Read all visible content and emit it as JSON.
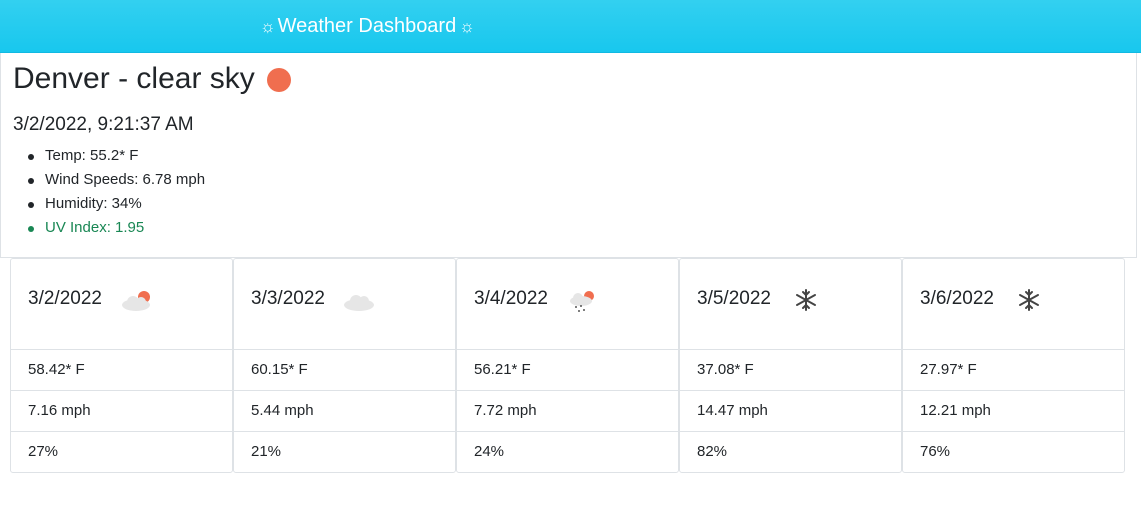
{
  "header": {
    "title": "Weather Dashboard",
    "left_icon": "sun-icon",
    "right_icon": "sun-icon"
  },
  "current": {
    "city": "Denver",
    "separator": "-",
    "description": "clear sky",
    "icon": "clear-day-icon",
    "datetime": "3/2/2022, 9:21:37 AM",
    "metrics": [
      "Temp: 55.2* F",
      "Wind Speeds: 6.78 mph",
      "Humidity: 34%",
      "UV Index: 1.95"
    ],
    "uv_color": "#198754",
    "sun_color": "#f06e4f"
  },
  "forecast": [
    {
      "date": "3/2/2022",
      "icon": "partly-cloudy-day-icon",
      "temp": "58.42* F",
      "wind": "7.16 mph",
      "humidity": "27%"
    },
    {
      "date": "3/3/2022",
      "icon": "cloud-icon",
      "temp": "60.15* F",
      "wind": "5.44 mph",
      "humidity": "21%"
    },
    {
      "date": "3/4/2022",
      "icon": "snow-partly-cloudy-icon",
      "temp": "56.21* F",
      "wind": "7.72 mph",
      "humidity": "24%"
    },
    {
      "date": "3/5/2022",
      "icon": "snowflake-icon",
      "temp": "37.08* F",
      "wind": "14.47 mph",
      "humidity": "82%"
    },
    {
      "date": "3/6/2022",
      "icon": "snowflake-icon",
      "temp": "27.97* F",
      "wind": "12.21 mph",
      "humidity": "76%"
    }
  ],
  "colors": {
    "header": "#18c7ee",
    "text": "#212529",
    "border": "#dee2e6",
    "sun": "#f06e4f",
    "cloud": "#e6e6e6",
    "snow": "#444444"
  }
}
